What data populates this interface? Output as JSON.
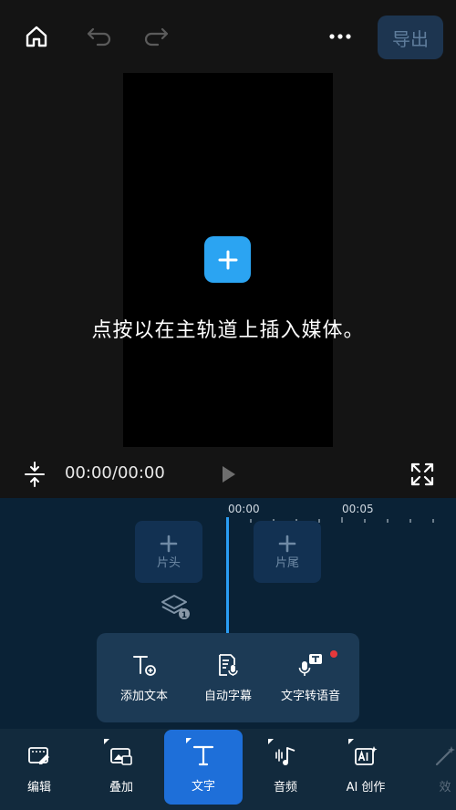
{
  "toolbar": {
    "export_label": "导出",
    "icons": [
      "home-icon",
      "undo-icon",
      "redo-icon",
      "more-icon"
    ]
  },
  "preview": {
    "hint": "点按以在主轨道上插入媒体。"
  },
  "playback": {
    "time": "00:00/00:00"
  },
  "timeline": {
    "ruler": [
      "00:00",
      "00:05"
    ],
    "head_label": "片头",
    "tail_label": "片尾",
    "layer_badge": "1"
  },
  "text_menu": {
    "items": [
      {
        "label": "添加文本",
        "icon": "add-text-icon"
      },
      {
        "label": "自动字幕",
        "icon": "auto-caption-icon"
      },
      {
        "label": "文字转语音",
        "icon": "text-to-speech-icon"
      }
    ]
  },
  "bottom_nav": {
    "items": [
      {
        "label": "编辑",
        "icon": "edit-icon"
      },
      {
        "label": "叠加",
        "icon": "overlay-icon"
      },
      {
        "label": "文字",
        "icon": "text-icon"
      },
      {
        "label": "音频",
        "icon": "audio-icon"
      },
      {
        "label": "AI 创作",
        "icon": "ai-create-icon"
      },
      {
        "label": "效",
        "icon": "effects-icon"
      }
    ],
    "active": "文字"
  },
  "colors": {
    "accent": "#2ba4f2",
    "active_tab": "#1e6fd9",
    "timeline_bg": "#0a2236",
    "badge": "#e5383b"
  }
}
